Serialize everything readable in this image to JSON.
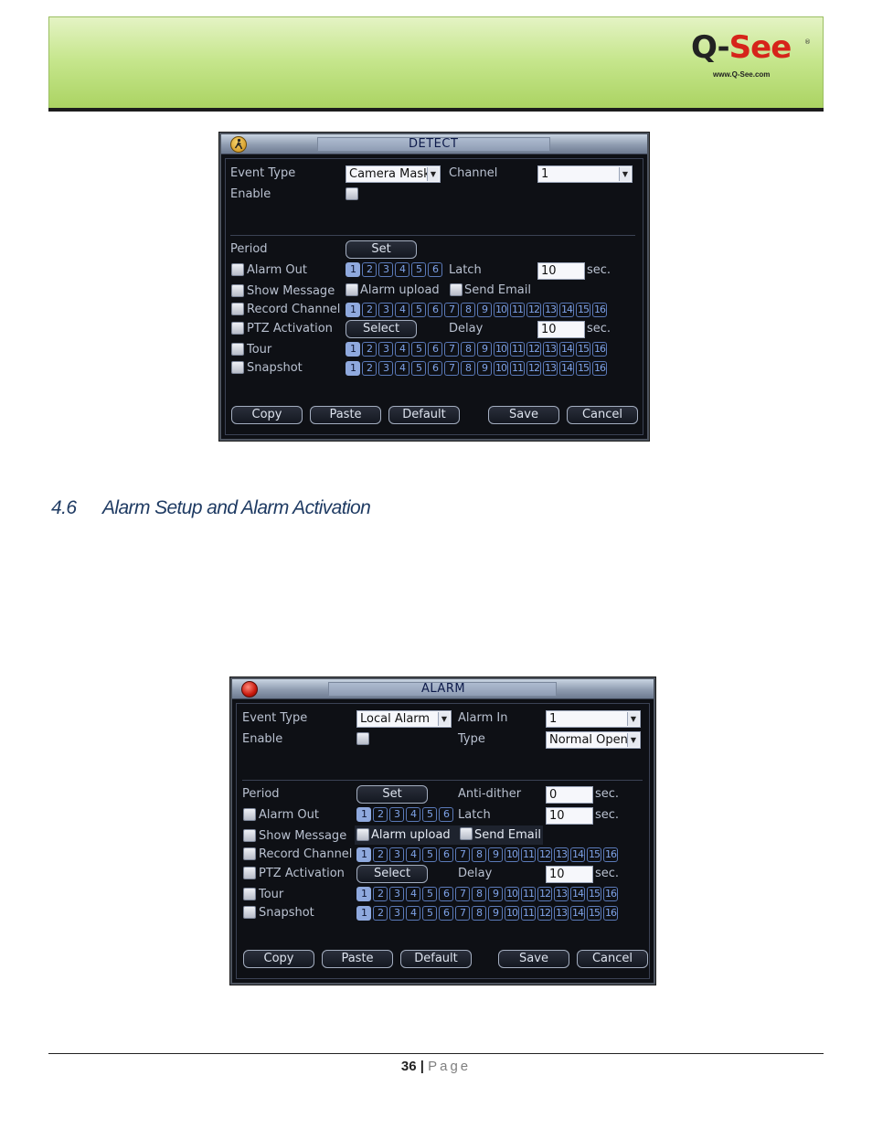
{
  "header": {
    "logo_q": "Q-",
    "logo_see": "See",
    "logo_reg": "®",
    "logo_url": "www.Q-See.com"
  },
  "detect": {
    "title": "DETECT",
    "event_type_label": "Event Type",
    "event_type_value": "Camera Maski",
    "channel_label": "Channel",
    "channel_value": "1",
    "enable_label": "Enable",
    "period_label": "Period",
    "set_label": "Set",
    "alarm_out_label": "Alarm Out",
    "alarm_out_nums": [
      "1",
      "2",
      "3",
      "4",
      "5",
      "6"
    ],
    "latch_label": "Latch",
    "latch_value": "10",
    "latch_unit": "sec.",
    "show_message_label": "Show Message",
    "alarm_upload_label": "Alarm upload",
    "send_email_label": "Send Email",
    "record_channel_label": "Record Channel",
    "ptz_label": "PTZ Activation",
    "select_label": "Select",
    "delay_label": "Delay",
    "delay_value": "10",
    "delay_unit": "sec.",
    "tour_label": "Tour",
    "snapshot_label": "Snapshot",
    "channel_nums": [
      "1",
      "2",
      "3",
      "4",
      "5",
      "6",
      "7",
      "8",
      "9",
      "10",
      "11",
      "12",
      "13",
      "14",
      "15",
      "16"
    ],
    "buttons": {
      "copy": "Copy",
      "paste": "Paste",
      "default": "Default",
      "save": "Save",
      "cancel": "Cancel"
    }
  },
  "heading": {
    "number": "4.6",
    "title": "Alarm Setup and Alarm Activation"
  },
  "alarm": {
    "title": "ALARM",
    "event_type_label": "Event Type",
    "event_type_value": "Local Alarm",
    "alarm_in_label": "Alarm In",
    "alarm_in_value": "1",
    "enable_label": "Enable",
    "type_label": "Type",
    "type_value": "Normal Open",
    "period_label": "Period",
    "set_label": "Set",
    "anti_dither_label": "Anti-dither",
    "anti_dither_value": "0",
    "anti_dither_unit": "sec.",
    "alarm_out_label": "Alarm Out",
    "alarm_out_nums": [
      "1",
      "2",
      "3",
      "4",
      "5",
      "6"
    ],
    "latch_label": "Latch",
    "latch_value": "10",
    "latch_unit": "sec.",
    "show_message_label": "Show Message",
    "alarm_upload_label": "Alarm upload",
    "send_email_label": "Send Email",
    "record_channel_label": "Record Channel",
    "ptz_label": "PTZ Activation",
    "select_label": "Select",
    "delay_label": "Delay",
    "delay_value": "10",
    "delay_unit": "sec.",
    "tour_label": "Tour",
    "snapshot_label": "Snapshot",
    "channel_nums": [
      "1",
      "2",
      "3",
      "4",
      "5",
      "6",
      "7",
      "8",
      "9",
      "10",
      "11",
      "12",
      "13",
      "14",
      "15",
      "16"
    ],
    "buttons": {
      "copy": "Copy",
      "paste": "Paste",
      "default": "Default",
      "save": "Save",
      "cancel": "Cancel"
    }
  },
  "footer": {
    "page_number": "36",
    "separator": "|",
    "page_word": "Page"
  },
  "colors": {
    "header_green": "#a9d25f",
    "heading_blue": "#1f3b63",
    "logo_red": "#d6241a",
    "dialog_bg": "#0e1015",
    "num_blue": "#7fa3e8"
  }
}
